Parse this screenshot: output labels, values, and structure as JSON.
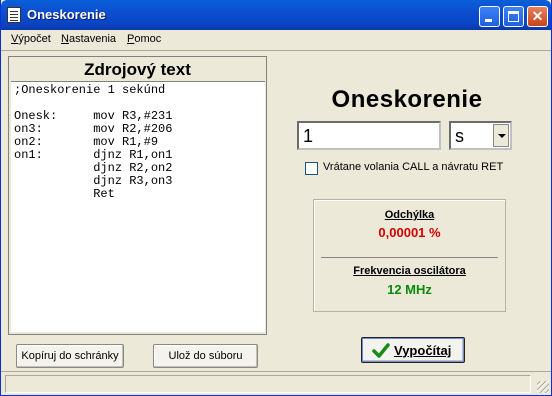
{
  "window": {
    "title": "Oneskorenie",
    "icon": "document-icon"
  },
  "menu": [
    {
      "first": "V",
      "rest": "ýpočet"
    },
    {
      "first": "N",
      "rest": "astavenia"
    },
    {
      "first": "P",
      "rest": "omoc"
    }
  ],
  "source": {
    "heading": "Zdrojový text",
    "code": ";Oneskorenie 1 sekúnd\n\nOnesk:     mov R3,#231\non3:       mov R2,#206\non2:       mov R1,#9\non1:       djnz R1,on1\n           djnz R2,on2\n           djnz R3,on3\n           Ret"
  },
  "buttons": {
    "copy": "Kopíruj do schránky",
    "save": "Ulož do súboru",
    "calculate_first": "V",
    "calculate_rest": "ypočítaj"
  },
  "delay": {
    "title": "Oneskorenie",
    "value": "1",
    "unit": "s",
    "include_call_label": "Vrátane volania CALL a návratu RET",
    "include_call_checked": false
  },
  "results": {
    "deviation_label": "Odchýlka",
    "deviation_value": "0,00001  %",
    "frequency_label": "Frekvencia oscilátora",
    "frequency_value": "12 MHz"
  },
  "colors": {
    "deviation": "#d40000",
    "frequency": "#0a8a0a"
  }
}
